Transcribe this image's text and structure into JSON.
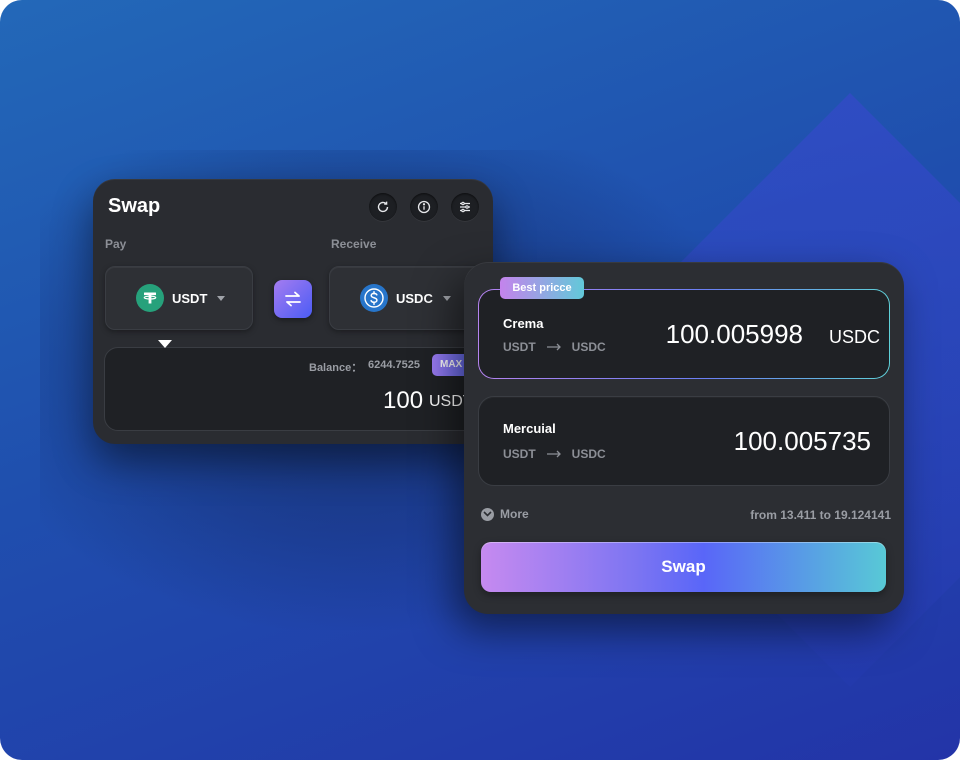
{
  "swap_card": {
    "title": "Swap",
    "pay_label": "Pay",
    "receive_label": "Receive",
    "pay_token": "USDT",
    "receive_token": "USDC",
    "balance_label": "Balance：",
    "balance_value": "6244.7525",
    "max_label": "MAX",
    "amount": "100",
    "amount_unit": "USDT",
    "icons": [
      "refresh-icon",
      "info-icon",
      "settings-sliders-icon",
      "swap-direction-icon"
    ]
  },
  "routes": {
    "best_tag": "Best pricce",
    "items": [
      {
        "dex": "Crema",
        "from": "USDT",
        "to": "USDC",
        "output": "100.005998",
        "unit": "USDC"
      },
      {
        "dex": "Mercuial",
        "from": "USDT",
        "to": "USDC",
        "output": "100.005735",
        "unit": ""
      }
    ],
    "more_label": "More",
    "range_text": "from 13.411 to 19.124141",
    "swap_button": "Swap"
  },
  "colors": {
    "background": "#2368b8",
    "card": "#2c2e33",
    "usdt_green": "#26a17b",
    "usdc_blue": "#2775ca",
    "accent_purple": "#a47cf0",
    "accent_blue": "#4b5cf5",
    "accent_teal": "#5fd0d8"
  }
}
